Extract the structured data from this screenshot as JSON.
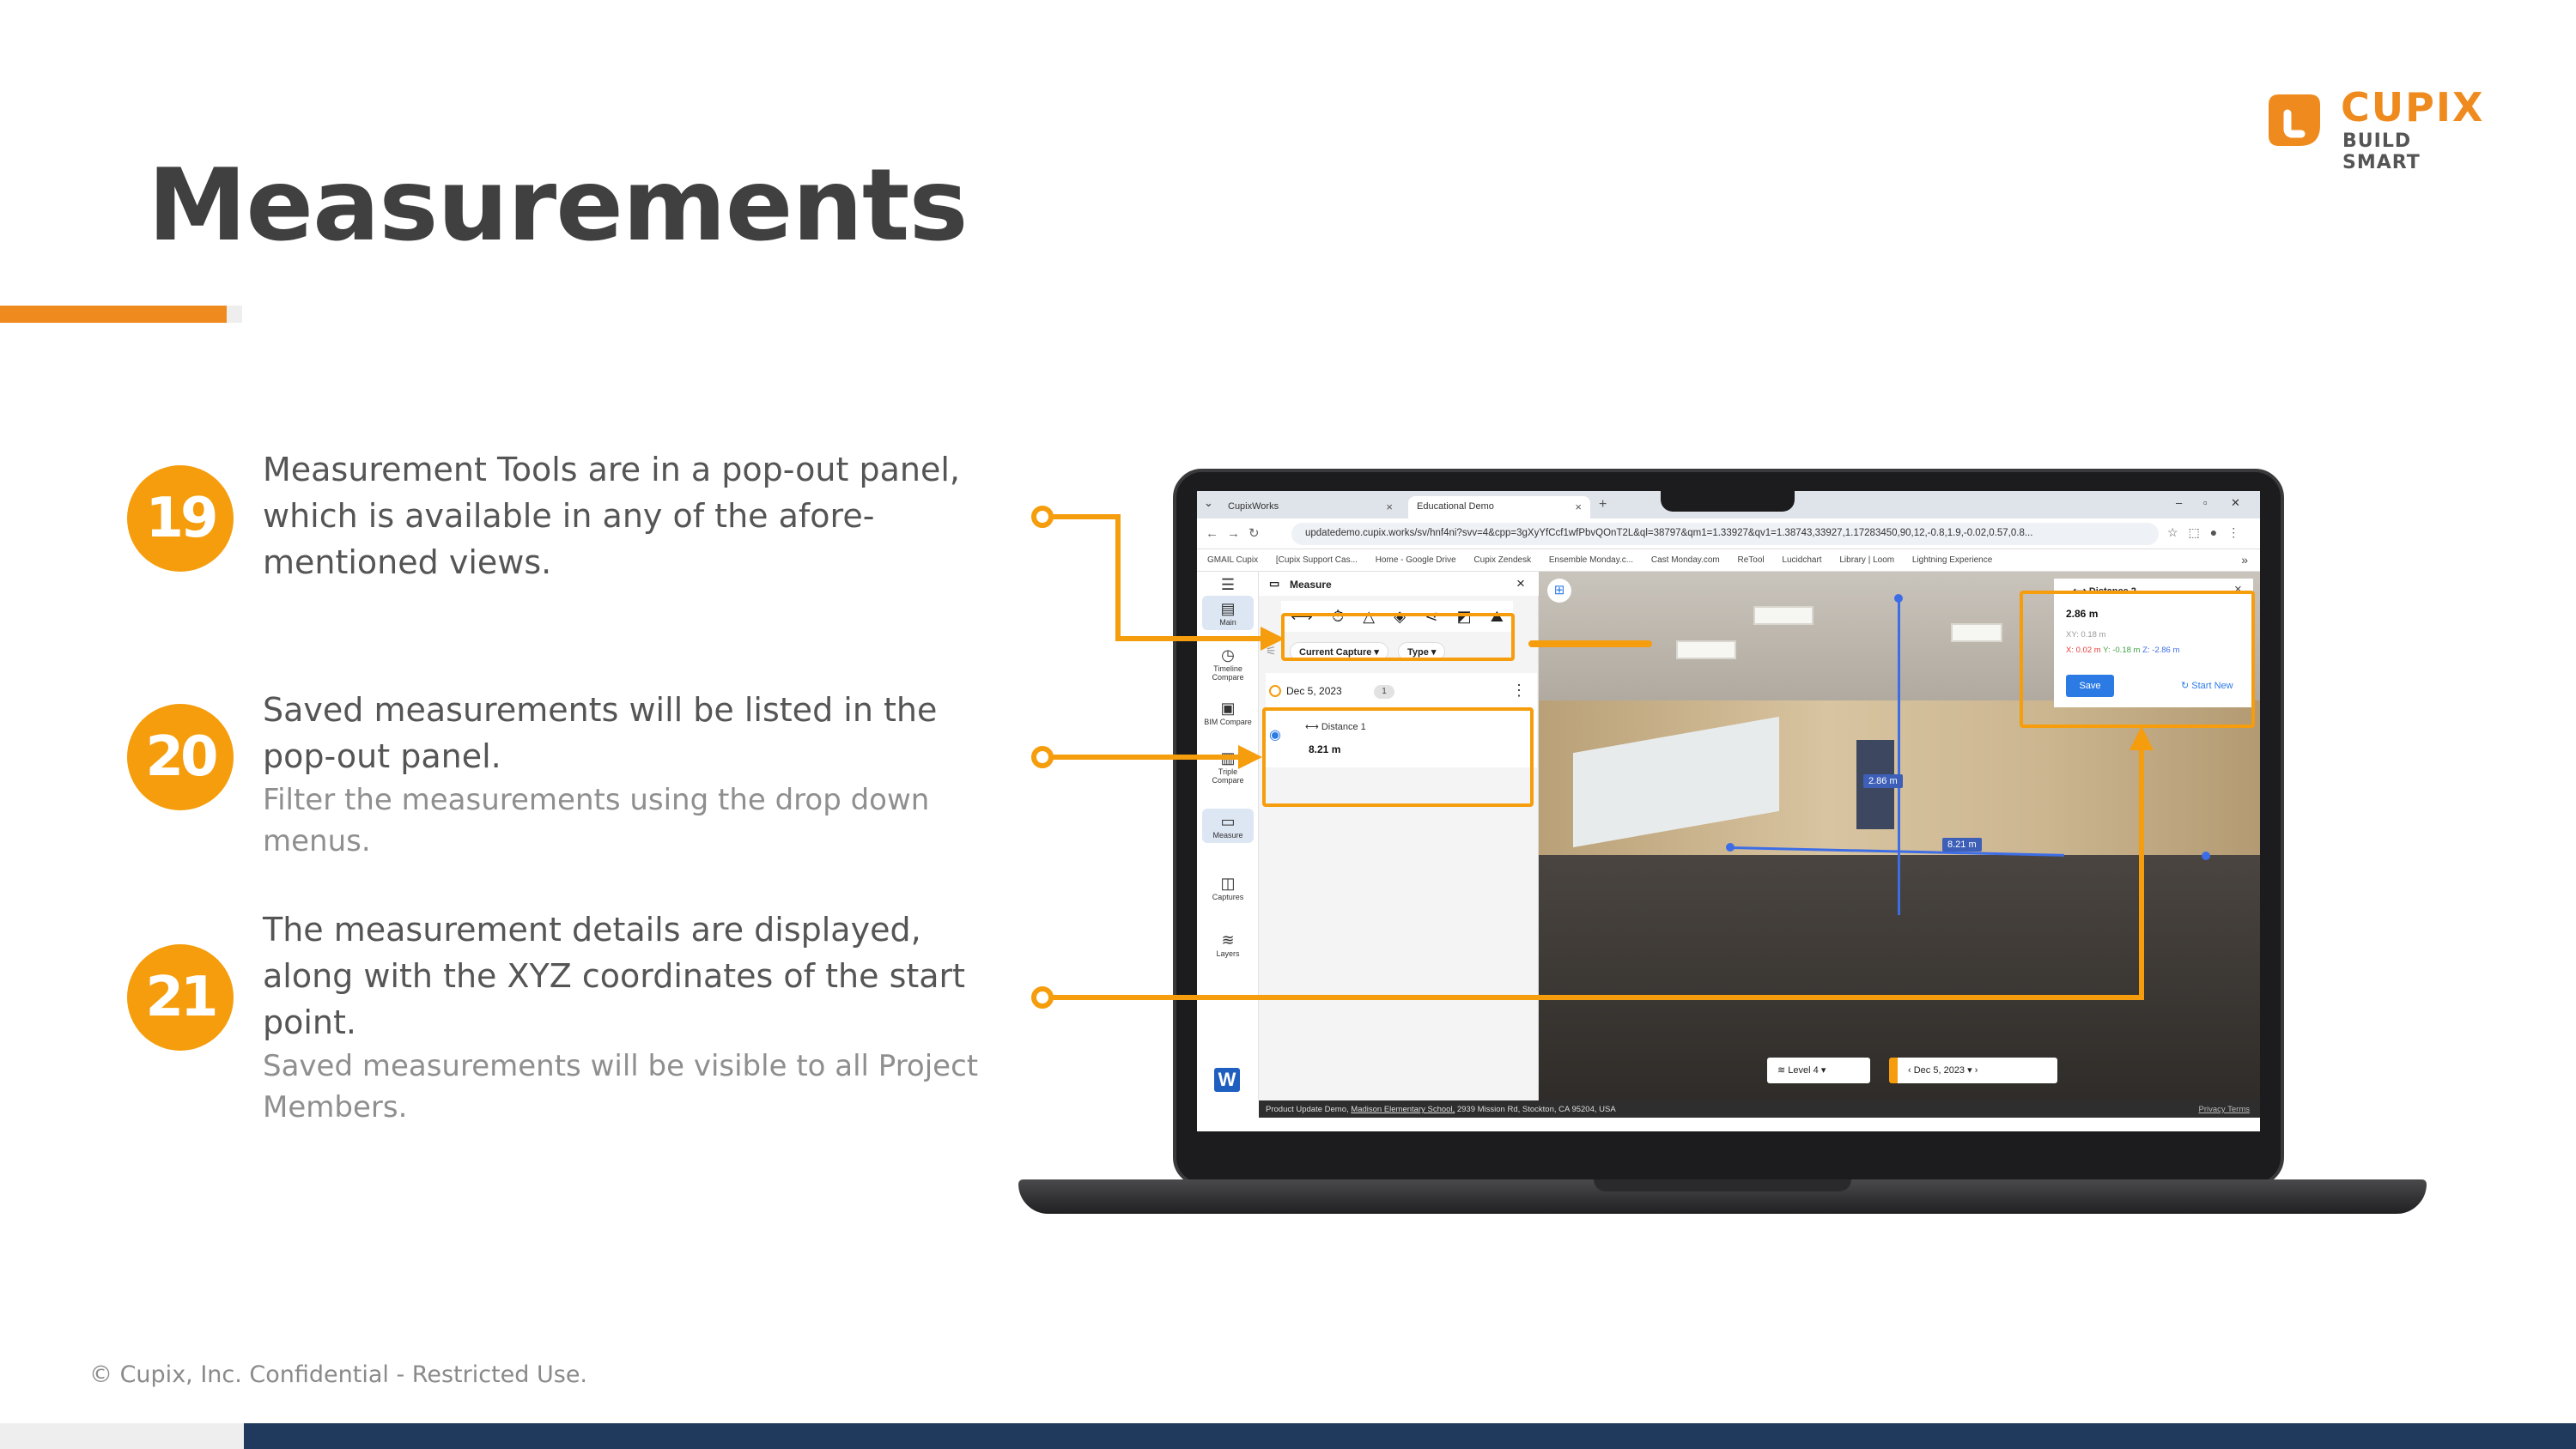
{
  "slide": {
    "title": "Measurements",
    "footer": "© Cupix, Inc. Confidential - Restricted Use."
  },
  "logo": {
    "name": "CUPIX",
    "tagline": "BUILD SMART"
  },
  "steps": [
    {
      "number": "19",
      "text": "Measurement Tools are in a pop-out panel, which is available in any of the afore-mentioned views.",
      "sub": ""
    },
    {
      "number": "20",
      "text": "Saved measurements will be listed in the pop-out panel.",
      "sub": "Filter the measurements using the drop down menus."
    },
    {
      "number": "21",
      "text": "The measurement details are displayed, along with the XYZ coordinates of the start point.",
      "sub": "Saved measurements will be visible to all Project Members."
    }
  ],
  "browser": {
    "tabs": [
      {
        "label": "CupixWorks"
      },
      {
        "label": "Educational Demo"
      }
    ],
    "url": "updatedemo.cupix.works/sv/hnf4ni?svv=4&cpp=3gXyYfCcf1wfPbvQOnT2L&ql=38797&qm1=1.33927&qv1=1.38743,33927,1.17283450,90,12,-0.8,1.9,-0.02,0.57,0.8...",
    "bookmarks": [
      "GMAIL Cupix",
      "[Cupix Support Cas...",
      "Home - Google Drive",
      "Cupix Zendesk",
      "Ensemble Monday.c...",
      "Cast Monday.com",
      "ReTool",
      "Lucidchart",
      "Library | Loom",
      "Lightning Experience"
    ]
  },
  "app": {
    "nav": [
      {
        "label": "Main",
        "icon": "grid-icon"
      },
      {
        "label": "Timeline Compare",
        "icon": "clock-icon"
      },
      {
        "label": "BIM Compare",
        "icon": "bim-icon"
      },
      {
        "label": "Triple Compare",
        "icon": "columns-icon"
      },
      {
        "label": "Measure",
        "icon": "ruler-icon"
      },
      {
        "label": "Captures",
        "icon": "capture-icon"
      },
      {
        "label": "Layers",
        "icon": "layers-icon"
      }
    ],
    "panel": {
      "title": "Measure",
      "tools": [
        "distance-tool-icon",
        "timer-tool-icon",
        "angle-tool-icon",
        "area-tool-icon",
        "path-tool-icon",
        "volume-tool-icon",
        "slope-tool-icon"
      ],
      "filter_capture": "Current Capture",
      "filter_type": "Type",
      "saved_group_date": "Dec 5, 2023",
      "saved_group_count": "1",
      "saved_item_name": "Distance 1",
      "saved_item_value": "8.21 m"
    },
    "view": {
      "label_vertical": "2.86 m",
      "label_horizontal": "8.21 m",
      "card_title": "Distance 2",
      "card_value": "2.86 m",
      "card_xy": "XY: 0.18 m",
      "card_x": "X: 0.02 m",
      "card_y": "Y: -0.18 m",
      "card_z": "Z: -2.86 m",
      "save_label": "Save",
      "start_new_label": "Start New",
      "level": "Level 4",
      "date": "Dec 5, 2023"
    },
    "status": {
      "prefix": "Product Update Demo,",
      "school": "Madison Elementary School,",
      "address": "2939 Mission Rd, Stockton, CA 95204, USA",
      "links": "Privacy  Terms"
    }
  },
  "colors": {
    "accent": "#ef8b1e",
    "step": "#f59d0c",
    "footer_bar": "#1f3a5c",
    "measure_line": "#3d6de6",
    "primary_button": "#2c7be5"
  }
}
